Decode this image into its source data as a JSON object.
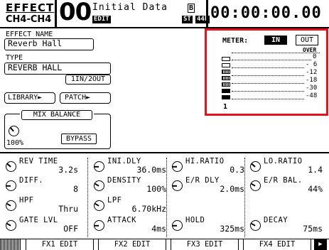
{
  "header": {
    "title": "EFFECT",
    "channel": "CH4-CH4",
    "scene_number": "00",
    "edit_badge": "EDIT",
    "scene_title": "Initial Data",
    "lock_icon": "B",
    "status_badges": [
      "ST",
      "44k"
    ],
    "timecode": "00:00:00.00"
  },
  "effect_name": {
    "label": "EFFECT NAME",
    "value": "Reverb Hall"
  },
  "type": {
    "label": "TYPE",
    "value": "REVERB HALL",
    "io": "1IN/2OUT"
  },
  "buttons": {
    "library": "LIBRARY",
    "patch": "PATCH",
    "bypass": "BYPASS"
  },
  "mix_balance": {
    "label": "MIX BALANCE",
    "value": "100%"
  },
  "meter": {
    "label": "METER:",
    "in_label": "IN",
    "out_label": "OUT",
    "selected": "IN",
    "scale": [
      "OVER",
      "0",
      "- 6",
      "-12",
      "-18",
      "-30",
      "-48"
    ],
    "channel_number": "1",
    "levels": [
      0.0,
      0.0,
      0.5,
      0.5,
      0.5,
      1.0,
      1.0
    ]
  },
  "params": [
    {
      "name": "REV TIME",
      "value": "3.2s"
    },
    {
      "name": "INI.DLY",
      "value": "36.0ms"
    },
    {
      "name": "HI.RATIO",
      "value": "0.3"
    },
    {
      "name": "LO.RATIO",
      "value": "1.4"
    },
    {
      "name": "DIFF.",
      "value": "8"
    },
    {
      "name": "DENSITY",
      "value": "100%"
    },
    {
      "name": "E/R DLY",
      "value": "2.0ms"
    },
    {
      "name": "E/R BAL.",
      "value": "44%"
    },
    {
      "name": "HPF",
      "value": "Thru"
    },
    {
      "name": "LPF",
      "value": "6.70kHz"
    },
    {
      "name": "",
      "value": ""
    },
    {
      "name": "",
      "value": ""
    },
    {
      "name": "GATE LVL",
      "value": "OFF"
    },
    {
      "name": "ATTACK",
      "value": "4ms"
    },
    {
      "name": "HOLD",
      "value": "325ms"
    },
    {
      "name": "DECAY",
      "value": "75ms"
    }
  ],
  "tabs": [
    "FX1 EDIT",
    "FX2 EDIT",
    "FX3 EDIT",
    "FX4 EDIT"
  ],
  "highlight_color": "#e8101a"
}
